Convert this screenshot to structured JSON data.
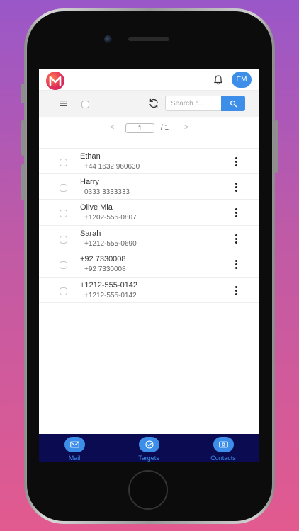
{
  "header": {
    "avatar_initials": "EM"
  },
  "toolbar": {
    "search_placeholder": "Search c..."
  },
  "pagination": {
    "prev": "<",
    "current_page": "1",
    "of_text": "/ 1",
    "next": ">"
  },
  "contacts": [
    {
      "name": "Ethan",
      "phone": "+44 1632 960630"
    },
    {
      "name": "Harry",
      "phone": "0333 3333333"
    },
    {
      "name": "Olive Mia",
      "phone": "+1202-555-0807"
    },
    {
      "name": "Sarah",
      "phone": "+1212-555-0690"
    },
    {
      "name": "+92 7330008",
      "phone": "+92 7330008"
    },
    {
      "name": "+1212-555-0142",
      "phone": "+1212-555-0142"
    }
  ],
  "bottom_nav": [
    {
      "label": "Mail",
      "icon": "mail-icon"
    },
    {
      "label": "Targets",
      "icon": "check-circle-icon"
    },
    {
      "label": "Contacts",
      "icon": "contact-card-icon"
    }
  ],
  "colors": {
    "accent": "#3d8ee8",
    "nav_background": "#0b0b52",
    "background_top": "#9a57c8",
    "background_bottom": "#e25a8f"
  }
}
